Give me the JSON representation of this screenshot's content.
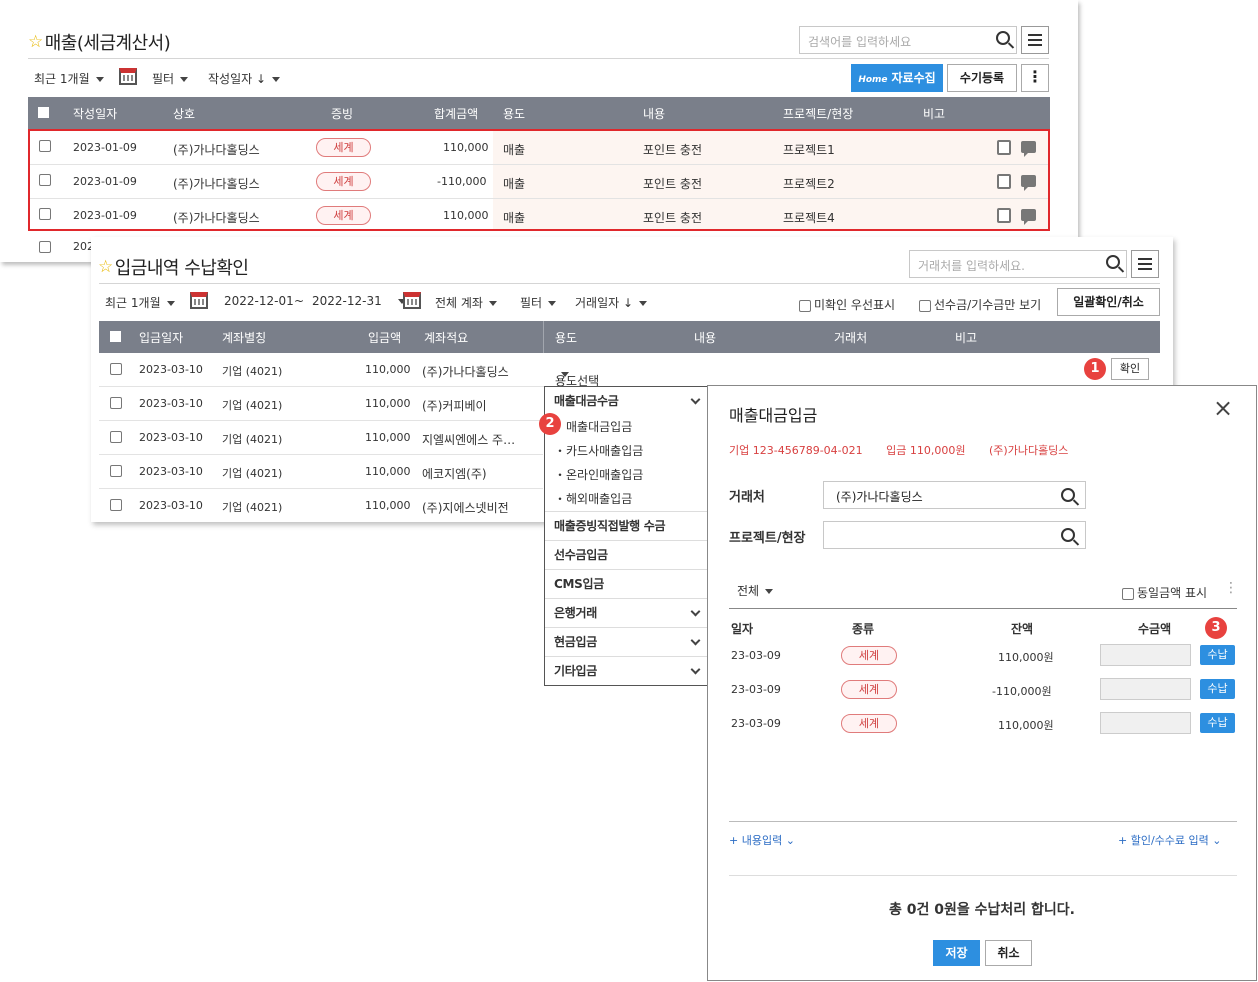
{
  "sales": {
    "title": "매출(세금계산서)",
    "search_placeholder": "검색어를 입력하세요",
    "period": "최근 1개월",
    "filter": "필터",
    "sort": "작성일자 ↓",
    "collect_btn": "자료수집",
    "collect_logo": "Home",
    "manual_btn": "수기등록",
    "columns": [
      "작성일자",
      "상호",
      "증빙",
      "합계금액",
      "용도",
      "내용",
      "프로젝트/현장",
      "비고"
    ],
    "rows": [
      {
        "date": "2023-01-09",
        "company": "(주)가나다홀딩스",
        "proof": "세계",
        "amount": "110,000",
        "use": "매출",
        "content": "포인트 충전",
        "project": "프로젝트1"
      },
      {
        "date": "2023-01-09",
        "company": "(주)가나다홀딩스",
        "proof": "세계",
        "amount": "-110,000",
        "use": "매출",
        "content": "포인트 충전",
        "project": "프로젝트2"
      },
      {
        "date": "2023-01-09",
        "company": "(주)가나다홀딩스",
        "proof": "세계",
        "amount": "110,000",
        "use": "매출",
        "content": "포인트 충전",
        "project": "프로젝트4"
      }
    ],
    "partial_row": "202"
  },
  "deposit": {
    "title": "입금내역 수납확인",
    "search_placeholder": "거래처를 입력하세요.",
    "period": "최근 1개월",
    "date_from": "2022-12-01",
    "tilde": "~",
    "date_to": "2022-12-31",
    "account": "전체 계좌",
    "filter": "필터",
    "sort": "거래일자 ↓",
    "unconfirmed": "미확인 우선표시",
    "advance": "선수금/기수금만 보기",
    "bulk_btn": "일괄확인/취소",
    "columns": [
      "입금일자",
      "계좌별칭",
      "입금액",
      "계좌적요",
      "용도",
      "내용",
      "거래처",
      "비고"
    ],
    "rows": [
      {
        "date": "2023-03-10",
        "account": "기업 (4021)",
        "amount": "110,000",
        "memo": "(주)가나다홀딩스"
      },
      {
        "date": "2023-03-10",
        "account": "기업 (4021)",
        "amount": "110,000",
        "memo": "(주)커피베이"
      },
      {
        "date": "2023-03-10",
        "account": "기업 (4021)",
        "amount": "110,000",
        "memo": "지엘씨엔에스 주…"
      },
      {
        "date": "2023-03-10",
        "account": "기업 (4021)",
        "amount": "110,000",
        "memo": "에코지엠(주)"
      },
      {
        "date": "2023-03-10",
        "account": "기업 (4021)",
        "amount": "110,000",
        "memo": "(주)지에스넷비전"
      }
    ],
    "use_select": "용도선택",
    "confirm_btn": "확인"
  },
  "menu": {
    "group1": "매출대금수금",
    "subs": [
      "매출대금입금",
      "・카드사매출입금",
      "・온라인매출입금",
      "・해외매출입금"
    ],
    "items": [
      "매출증빙직접발행 수금",
      "선수금입금",
      "CMS입금",
      "은행거래",
      "현금입금",
      "기타입금"
    ]
  },
  "badges": [
    "1",
    "2",
    "3"
  ],
  "dialog": {
    "title": "매출대금입금",
    "bank": "기업",
    "account_no": "123-456789-04-021",
    "deposit": "입금 110,000원",
    "company": "(주)가나다홀딩스",
    "partner_label": "거래처",
    "partner_value": "(주)가나다홀딩스",
    "project_label": "프로젝트/현장",
    "filter": "전체",
    "same_amount": "동일금액 표시",
    "columns": [
      "일자",
      "종류",
      "잔액",
      "수금액"
    ],
    "rows": [
      {
        "date": "23-03-09",
        "type": "세계",
        "balance": "110,000원",
        "btn": "수납"
      },
      {
        "date": "23-03-09",
        "type": "세계",
        "balance": "-110,000원",
        "btn": "수납"
      },
      {
        "date": "23-03-09",
        "type": "세계",
        "balance": "110,000원",
        "btn": "수납"
      }
    ],
    "content_input": "+ 내용입력",
    "discount_input": "+ 할인/수수료 입력",
    "summary": "총 0건 0원을 수납처리 합니다.",
    "save": "저장",
    "cancel": "취소"
  },
  "colors": {
    "header": "#7a7f8a",
    "highlight": "#e8423f",
    "accent": "#2d8fe0"
  }
}
